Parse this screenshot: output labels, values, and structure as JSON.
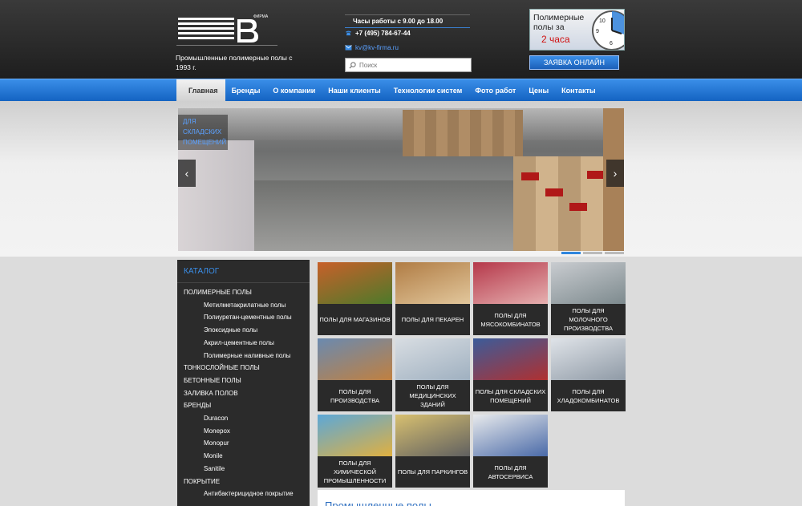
{
  "header": {
    "logo_firm": "ФИРМА",
    "tagline": "Промышленные полимерные полы с 1993 г.",
    "hours": "Часы работы с 9.00 до 18.00",
    "phone": "+7 (495) 784-67-44",
    "email": "kv@kv-firma.ru",
    "search_placeholder": "Поиск",
    "promo_line1": "Полимерные полы за",
    "promo_line2": "2 часа",
    "order_button": "ЗАЯВКА ОНЛАЙН"
  },
  "nav": [
    {
      "label": "Главная",
      "active": true
    },
    {
      "label": "Бренды"
    },
    {
      "label": "О компании"
    },
    {
      "label": "Наши клиенты"
    },
    {
      "label": "Технологии систем"
    },
    {
      "label": "Фото работ"
    },
    {
      "label": "Цены"
    },
    {
      "label": "Контакты"
    }
  ],
  "slider": {
    "caption": "для складских помещений",
    "prev": "‹",
    "next": "›"
  },
  "catalog": {
    "title": "КАТАЛОГ",
    "items": [
      {
        "label": "ПОЛИМЕРНЫЕ ПОЛЫ",
        "level": 0
      },
      {
        "label": "Метилметакрилатные полы",
        "level": 1
      },
      {
        "label": "Полиуретан-цементные полы",
        "level": 1
      },
      {
        "label": "Эпоксидные полы",
        "level": 1
      },
      {
        "label": "Акрил-цементные полы",
        "level": 1
      },
      {
        "label": "Полимерные наливные полы",
        "level": 1
      },
      {
        "label": "ТОНКОСЛОЙНЫЕ ПОЛЫ",
        "level": 0
      },
      {
        "label": "БЕТОННЫЕ ПОЛЫ",
        "level": 0
      },
      {
        "label": "ЗАЛИВКА ПОЛОВ",
        "level": 0
      },
      {
        "label": "БРЕНДЫ",
        "level": 0
      },
      {
        "label": "Duracon",
        "level": 1
      },
      {
        "label": "Monepox",
        "level": 1
      },
      {
        "label": "Monopur",
        "level": 1
      },
      {
        "label": "Monile",
        "level": 1
      },
      {
        "label": "Sanitile",
        "level": 1
      },
      {
        "label": "ПОКРЫТИЕ",
        "level": 0
      },
      {
        "label": "Антибактерицидное покрытие",
        "level": 1
      }
    ]
  },
  "tiles": [
    {
      "label": "Полы для магазинов",
      "c1": "#c8602a",
      "c2": "#4d7a2a"
    },
    {
      "label": "Полы для пекарен",
      "c1": "#b07c44",
      "c2": "#e2c79c"
    },
    {
      "label": "Полы для мясокомбинатов",
      "c1": "#b5384a",
      "c2": "#e6b0b0"
    },
    {
      "label": "Полы для молочного производства",
      "c1": "#c9ccd0",
      "c2": "#7d8a8e"
    },
    {
      "label": "Полы для производства",
      "c1": "#6a8ab0",
      "c2": "#c08040"
    },
    {
      "label": "Полы для медицинских зданий",
      "c1": "#d8dde2",
      "c2": "#9fb0c0"
    },
    {
      "label": "Полы для складских помещений",
      "c1": "#3b5c9a",
      "c2": "#b03030"
    },
    {
      "label": "Полы для хладокомбинатов",
      "c1": "#dfe3e8",
      "c2": "#8f9aa6"
    },
    {
      "label": "Полы для химической промышленности",
      "c1": "#5ca8d8",
      "c2": "#e0b040"
    },
    {
      "label": "Полы для паркингов",
      "c1": "#d8c070",
      "c2": "#606060"
    },
    {
      "label": "Полы для автосервиса",
      "c1": "#e8eaec",
      "c2": "#4a6aa8"
    }
  ],
  "content": {
    "title": "Промышленные полы"
  }
}
